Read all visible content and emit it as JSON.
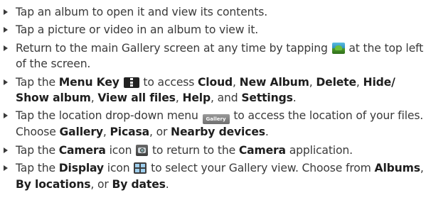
{
  "bullets": [
    {
      "text": "Tap an album to open it and view its contents."
    },
    {
      "text": "Tap a picture or video in an album to view it."
    },
    {
      "t1": "Return to the main Gallery screen at any time by tapping ",
      "icon": "gallery-app-icon",
      "t2": " at the top left of the screen."
    },
    {
      "t1": "Tap the ",
      "b1": "Menu Key",
      "icon": "menu-key-icon",
      "t2": " to access ",
      "b2": "Cloud",
      "t3": ", ",
      "b3": "New Album",
      "t4": ", ",
      "b4": "Delete",
      "t5": ", ",
      "b5": "Hide/ Show album",
      "t6": ", ",
      "b6": "View all files",
      "t7": ", ",
      "b7": "Help",
      "t8": ", and ",
      "b8": "Settings",
      "t9": "."
    },
    {
      "t1": "Tap the location drop-down menu ",
      "icon": "location-dropdown-icon",
      "icon_text": "Gallery",
      "t2": " to access the location of your files. Choose ",
      "b1": "Gallery",
      "t3": ", ",
      "b2": "Picasa",
      "t4": ", or ",
      "b3": "Nearby devices",
      "t5": "."
    },
    {
      "t1": "Tap the ",
      "b1": "Camera",
      "t2": " icon ",
      "icon": "camera-icon",
      "t3": " to return to the ",
      "b2": "Camera",
      "t4": " application."
    },
    {
      "t1": "Tap the ",
      "b1": "Display",
      "t2": " icon ",
      "icon": "display-icon",
      "t3": " to select your Gallery view. Choose from ",
      "b2": "Albums",
      "t4": ", ",
      "b3": "By locations",
      "t5": ", or ",
      "b4": "By dates",
      "t6": "."
    }
  ]
}
